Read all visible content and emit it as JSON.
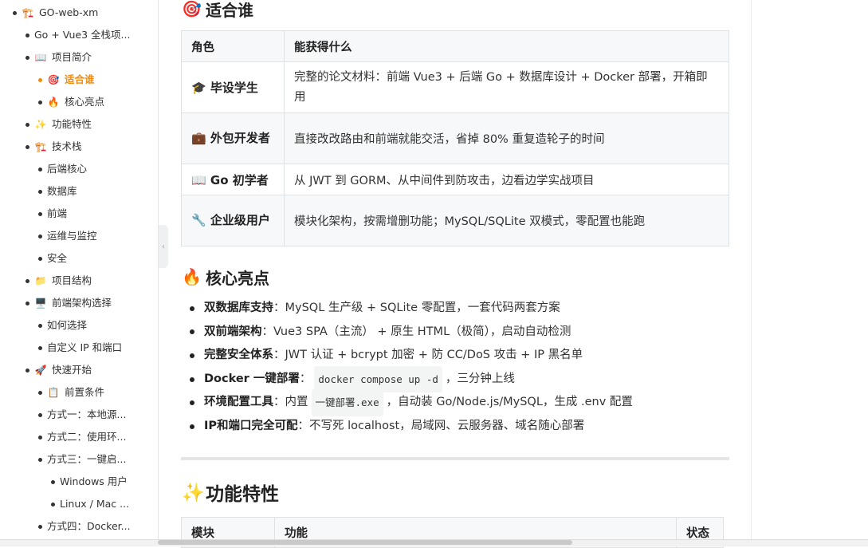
{
  "sidebar": {
    "items": [
      {
        "label": "GO-web-xm",
        "emoji": "🏗️",
        "level": 0
      },
      {
        "label": "Go + Vue3 全栈项...",
        "emoji": "",
        "level": 1
      },
      {
        "label": "项目简介",
        "emoji": "📖",
        "level": 1
      },
      {
        "label": "适合谁",
        "emoji": "🎯",
        "level": 2,
        "active": true
      },
      {
        "label": "核心亮点",
        "emoji": "🔥",
        "level": 2
      },
      {
        "label": "功能特性",
        "emoji": "✨",
        "level": 1
      },
      {
        "label": "技术栈",
        "emoji": "🏗️",
        "level": 1
      },
      {
        "label": "后端核心",
        "emoji": "",
        "level": 2
      },
      {
        "label": "数据库",
        "emoji": "",
        "level": 2
      },
      {
        "label": "前端",
        "emoji": "",
        "level": 2
      },
      {
        "label": "运维与监控",
        "emoji": "",
        "level": 2
      },
      {
        "label": "安全",
        "emoji": "",
        "level": 2
      },
      {
        "label": "项目结构",
        "emoji": "📁",
        "level": 1
      },
      {
        "label": "前端架构选择",
        "emoji": "🖥️",
        "level": 1
      },
      {
        "label": "如何选择",
        "emoji": "",
        "level": 2
      },
      {
        "label": "自定义 IP 和端口",
        "emoji": "",
        "level": 2
      },
      {
        "label": "快速开始",
        "emoji": "🚀",
        "level": 1
      },
      {
        "label": "前置条件",
        "emoji": "📋",
        "level": 2
      },
      {
        "label": "方式一：本地源...",
        "emoji": "",
        "level": 2
      },
      {
        "label": "方式二：使用环...",
        "emoji": "",
        "level": 2
      },
      {
        "label": "方式三：一键启...",
        "emoji": "",
        "level": 2
      },
      {
        "label": "Windows 用户",
        "emoji": "",
        "level": 3
      },
      {
        "label": "Linux / Mac ...",
        "emoji": "",
        "level": 3
      },
      {
        "label": "方式四：Docker...",
        "emoji": "",
        "level": 2
      }
    ]
  },
  "audience": {
    "heading": "适合谁",
    "heading_emoji": "🎯",
    "col_role": "角色",
    "col_gain": "能获得什么",
    "rows": [
      {
        "emoji": "🎓",
        "role": "毕设学生",
        "gain": "完整的论文材料：前端 Vue3 + 后端 Go + 数据库设计 + Docker 部署，开箱即用"
      },
      {
        "emoji": "💼",
        "role": "外包开发者",
        "gain": "直接改改路由和前端就能交活，省掉 80% 重复造轮子的时间"
      },
      {
        "emoji": "📖",
        "role": "Go 初学者",
        "gain": "从 JWT 到 GORM、从中间件到防攻击，边看边学实战项目"
      },
      {
        "emoji": "🔧",
        "role": "企业级用户",
        "gain": "模块化架构，按需增删功能；MySQL/SQLite 双模式，零配置也能跑"
      }
    ]
  },
  "highlights": {
    "heading": "核心亮点",
    "heading_emoji": "🔥",
    "items": [
      {
        "title": "双数据库支持",
        "pre": "：MySQL 生产级 + SQLite 零配置，一套代码两套方案",
        "code": "",
        "post": ""
      },
      {
        "title": "双前端架构",
        "pre": "：Vue3 SPA（主流） + 原生 HTML（极简），启动自动检测",
        "code": "",
        "post": ""
      },
      {
        "title": "完整安全体系",
        "pre": "：JWT 认证 + bcrypt 加密 + 防 CC/DoS 攻击 + IP 黑名单",
        "code": "",
        "post": ""
      },
      {
        "title": "Docker 一键部署",
        "pre": "：",
        "code": "docker compose up -d",
        "post": "，三分钟上线"
      },
      {
        "title": "环境配置工具",
        "pre": "：内置",
        "code": "一键部署.exe",
        "post": "，自动装 Go/Node.js/MySQL，生成 .env 配置"
      },
      {
        "title": "IP和端口完全可配",
        "pre": "：不写死 localhost，局域网、云服务器、域名随心部署",
        "code": "",
        "post": ""
      }
    ]
  },
  "features": {
    "heading": "功能特性",
    "heading_emoji": "✨",
    "col_module": "模块",
    "col_function": "功能",
    "col_status": "状态"
  }
}
